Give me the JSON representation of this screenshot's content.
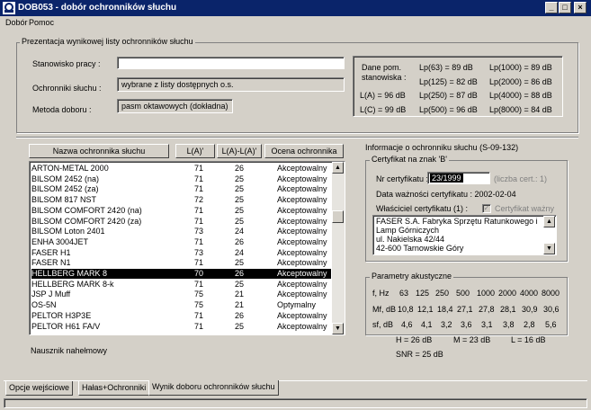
{
  "window": {
    "title": "DOB053 - dobór ochronników słuchu"
  },
  "menu": [
    "Dobór",
    "Pomoc"
  ],
  "presentation": {
    "group_title": "Prezentacja wynikowej listy ochronników słuchu",
    "workplace_label": "Stanowisko pracy :",
    "workplace_value": "",
    "protectors_label": "Ochronniki słuchu :",
    "protectors_value": "wybrane z listy dostępnych o.s.",
    "method_label": "Metoda doboru :",
    "method_value": "pasm oktawowych (dokładna)"
  },
  "station_data": {
    "label": "Dane pom. stanowiska :",
    "col1": [
      "L(A) = 96 dB",
      "L(C) = 99 dB"
    ],
    "col2": [
      "Lp(63) = 89 dB",
      "Lp(125) = 82 dB",
      "Lp(250) = 87 dB",
      "Lp(500) = 96 dB"
    ],
    "col3": [
      "Lp(1000) = 89 dB",
      "Lp(2000) = 86 dB",
      "Lp(4000) = 88 dB",
      "Lp(8000) = 84 dB"
    ]
  },
  "table": {
    "headers": [
      "Nazwa ochronnika słuchu",
      "L(A)'",
      "L(A)-L(A)'",
      "Ocena ochronnika"
    ],
    "selected_index": 10,
    "rows": [
      [
        "ARTON-METAL 2000",
        "71",
        "26",
        "Akceptowalny"
      ],
      [
        "BILSOM 2452 (na)",
        "71",
        "25",
        "Akceptowalny"
      ],
      [
        "BILSOM 2452 (za)",
        "71",
        "25",
        "Akceptowalny"
      ],
      [
        "BILSOM 817 NST",
        "72",
        "25",
        "Akceptowalny"
      ],
      [
        "BILSOM COMFORT 2420 (na)",
        "71",
        "25",
        "Akceptowalny"
      ],
      [
        "BILSOM COMFORT 2420 (za)",
        "71",
        "25",
        "Akceptowalny"
      ],
      [
        "BILSOM Loton 2401",
        "73",
        "24",
        "Akceptowalny"
      ],
      [
        "ENHA 3004JET",
        "71",
        "26",
        "Akceptowalny"
      ],
      [
        "FASER H1",
        "73",
        "24",
        "Akceptowalny"
      ],
      [
        "FASER N1",
        "71",
        "25",
        "Akceptowalny"
      ],
      [
        "HELLBERG MARK 8",
        "70",
        "26",
        "Akceptowalny"
      ],
      [
        "HELLBERG MARK 8-k",
        "71",
        "25",
        "Akceptowalny"
      ],
      [
        "JSP J Muff",
        "75",
        "21",
        "Akceptowalny"
      ],
      [
        "OS-5N",
        "75",
        "21",
        "Optymalny"
      ],
      [
        "PELTOR H3P3E",
        "71",
        "26",
        "Akceptowalny"
      ],
      [
        "PELTOR H61 FA/V",
        "71",
        "25",
        "Akceptowalny"
      ]
    ]
  },
  "status_item": "Nausznik nahełmowy",
  "info": {
    "title": "Informacje o ochronniku słuchu (S-09-132)",
    "cert_group": "Certyfikat na znak 'B'",
    "cert_no_label": "Nr certyfikatu :",
    "cert_no_value": "23/1999",
    "cert_count": "(liczba cert.: 1)",
    "validity": "Data ważności certyfikatu : 2002-02-04",
    "owner_label": "Właściciel certyfikatu (1) :",
    "valid_checkbox": "Certyfikat ważny",
    "owner_lines": [
      "FASER S.A. Fabryka Sprzętu Ratunkowego i",
      "Lamp Górniczych",
      "ul. Nakielska 42/44",
      "42-600 Tarnowskie Góry"
    ]
  },
  "acoustic": {
    "title": "Parametry akustyczne",
    "freq_label": "f, Hz",
    "freqs": [
      "63",
      "125",
      "250",
      "500",
      "1000",
      "2000",
      "4000",
      "8000"
    ],
    "mf_label": "Mf, dB",
    "mf": [
      "10,8",
      "12,1",
      "18,4",
      "27,1",
      "27,8",
      "28,1",
      "30,9",
      "30,6"
    ],
    "sf_label": "sf, dB",
    "sf": [
      "4,6",
      "4,1",
      "3,2",
      "3,6",
      "3,1",
      "3,8",
      "2,8",
      "5,6"
    ],
    "hml": [
      "H = 26 dB",
      "M = 23 dB",
      "L = 16 dB"
    ],
    "snr": "SNR = 25 dB"
  },
  "tabs": [
    "Opcje wejściowe",
    "Hałas+Ochronniki",
    "Wynik doboru ochronników słuchu"
  ]
}
